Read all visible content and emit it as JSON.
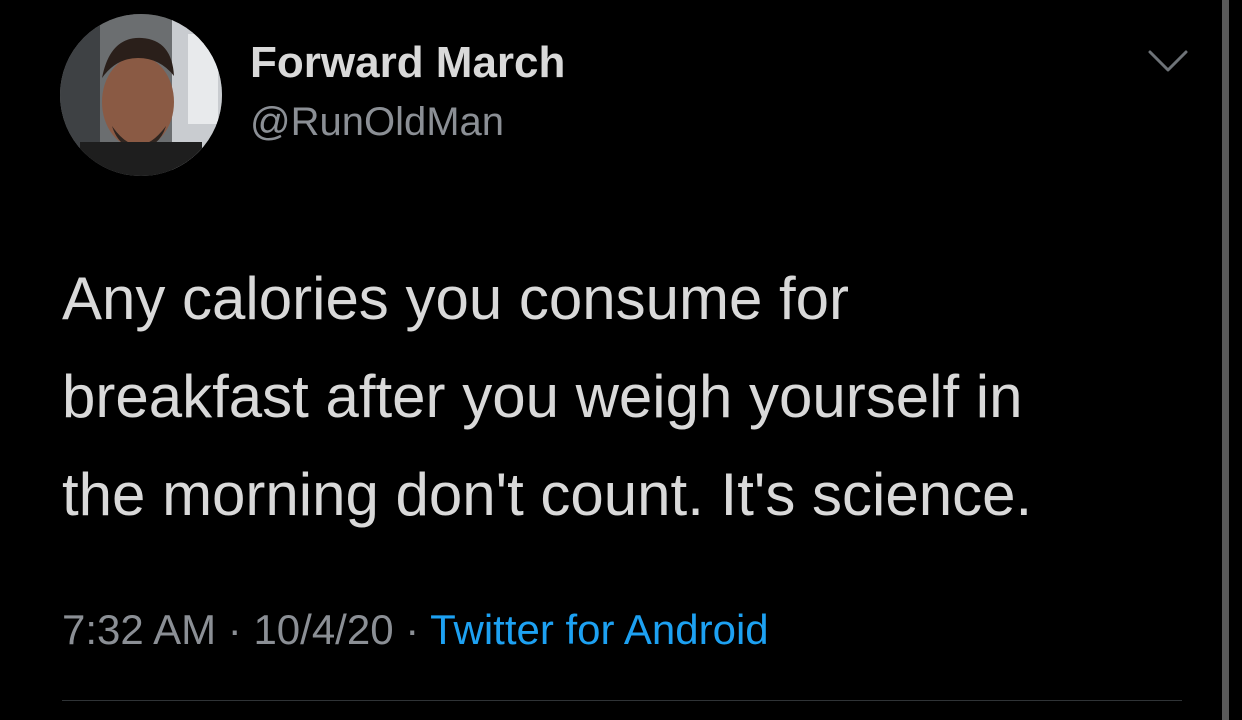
{
  "author": {
    "display_name": "Forward March",
    "handle": "@RunOldMan"
  },
  "tweet": {
    "lines": [
      "Any calories you consume for",
      "breakfast after you weigh yourself in",
      "the morning don't count. It's science."
    ]
  },
  "meta": {
    "time": "7:32 AM",
    "separator": " · ",
    "date": "10/4/20",
    "source": "Twitter for Android"
  },
  "icons": {
    "more": "chevron-down-icon",
    "avatar": "profile-photo"
  },
  "colors": {
    "background": "#000000",
    "primary_text": "#d9d9d9",
    "secondary_text": "#8b8f95",
    "link": "#1da1f2"
  }
}
